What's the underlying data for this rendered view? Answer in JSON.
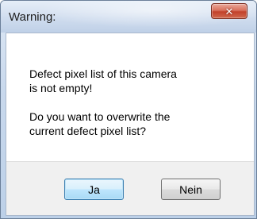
{
  "dialog": {
    "title": "Warning:",
    "close_symbol": "✕",
    "message_line_1": "Defect pixel list of this camera",
    "message_line_2": "is not empty!",
    "message_line_3": "Do you want to overwrite the",
    "message_line_4": "current defect pixel list?",
    "buttons": {
      "yes_label": "Ja",
      "no_label": "Nein"
    }
  }
}
